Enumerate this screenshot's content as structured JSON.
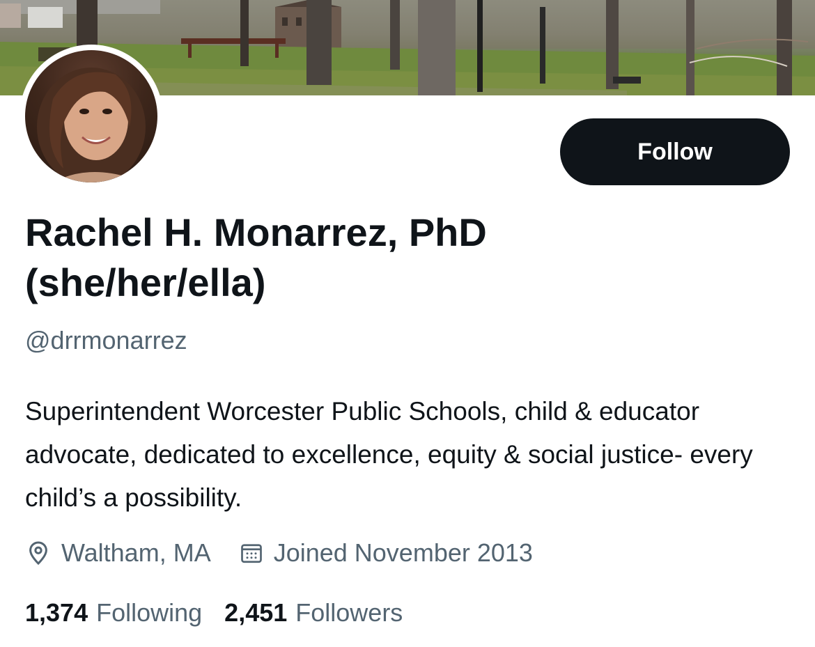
{
  "profile": {
    "display_name": "Rachel H. Monarrez, PhD (she/her/ella)",
    "handle": "@drrmonarrez",
    "bio": "Superintendent Worcester Public Schools, child & educator advocate, dedicated to excellence, equity & social justice- every child’s a possibility.",
    "location": "Waltham, MA",
    "joined": "Joined November 2013",
    "following_count": "1,374",
    "following_label": "Following",
    "followers_count": "2,451",
    "followers_label": "Followers"
  },
  "actions": {
    "follow_label": "Follow"
  },
  "icons": {
    "location": "location-pin-icon",
    "joined": "calendar-icon"
  },
  "colors": {
    "primary_text": "#0f1419",
    "secondary_text": "#536471",
    "button_bg": "#0f1419",
    "button_text": "#ffffff"
  }
}
